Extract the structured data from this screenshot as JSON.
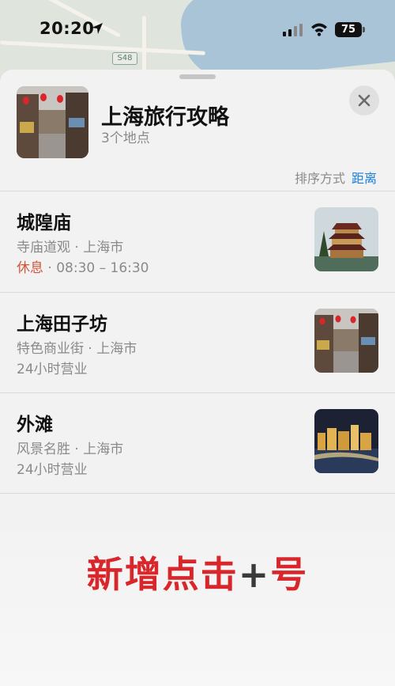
{
  "status_bar": {
    "time": "20:20",
    "battery": "75",
    "icons": [
      "location-arrow-icon",
      "cellular-signal-icon",
      "wifi-icon",
      "battery-icon"
    ]
  },
  "map": {
    "road_shield": "S48"
  },
  "guide": {
    "title": "上海旅行攻略",
    "count": "3个地点",
    "close_icon": "close-icon"
  },
  "sort": {
    "label": "排序方式",
    "value": "距离",
    "accent_color": "#1a7fd9"
  },
  "places": [
    {
      "name": "城隍庙",
      "meta": "寺庙道观 · 上海市",
      "status": "休息",
      "hours": " · 08:30 – 16:30",
      "status_color": "#d2553c"
    },
    {
      "name": "上海田子坊",
      "meta": "特色商业街 · 上海市",
      "hours": "24小时营业"
    },
    {
      "name": "外滩",
      "meta": "风景名胜 · 上海市",
      "hours": "24小时营业"
    }
  ],
  "caption": {
    "text_before": "新增点击",
    "plus": "+",
    "text_after": "号",
    "color": "#d8262a"
  }
}
